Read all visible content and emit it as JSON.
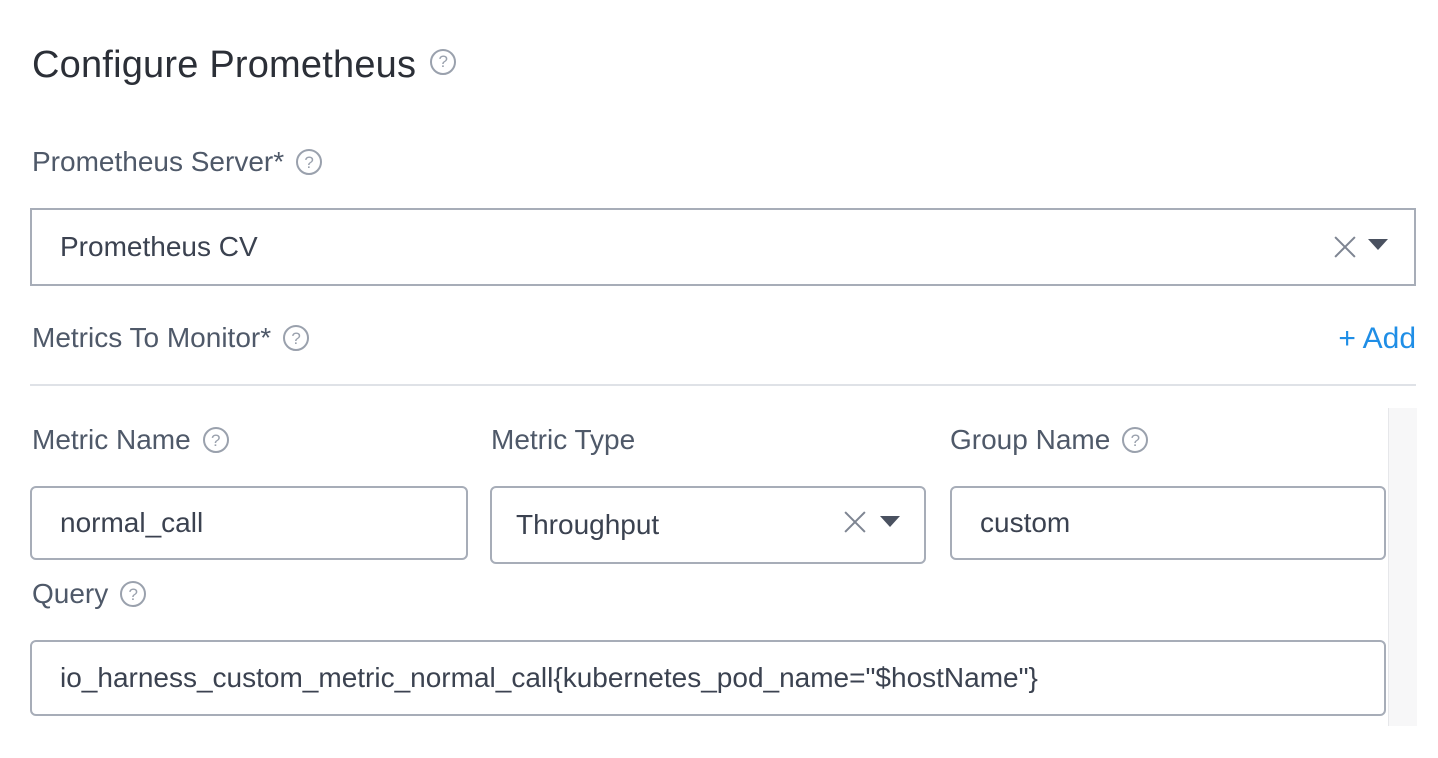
{
  "header": {
    "title": "Configure Prometheus",
    "help_icon": "question-circle-icon"
  },
  "server": {
    "label": "Prometheus Server*",
    "value": "Prometheus CV"
  },
  "metrics": {
    "label": "Metrics To Monitor*",
    "add_label": "+ Add",
    "accent_color": "#1f8ee6"
  },
  "metric_row": {
    "name_label": "Metric Name",
    "name_value": "normal_call",
    "type_label": "Metric Type",
    "type_value": "Throughput",
    "group_label": "Group Name",
    "group_value": "custom",
    "query_label": "Query",
    "query_value": "io_harness_custom_metric_normal_call{kubernetes_pod_name=\"$hostName\"}"
  },
  "icons": {
    "help": "question-circle-icon",
    "clear": "close-icon",
    "dropdown": "caret-down-icon"
  }
}
